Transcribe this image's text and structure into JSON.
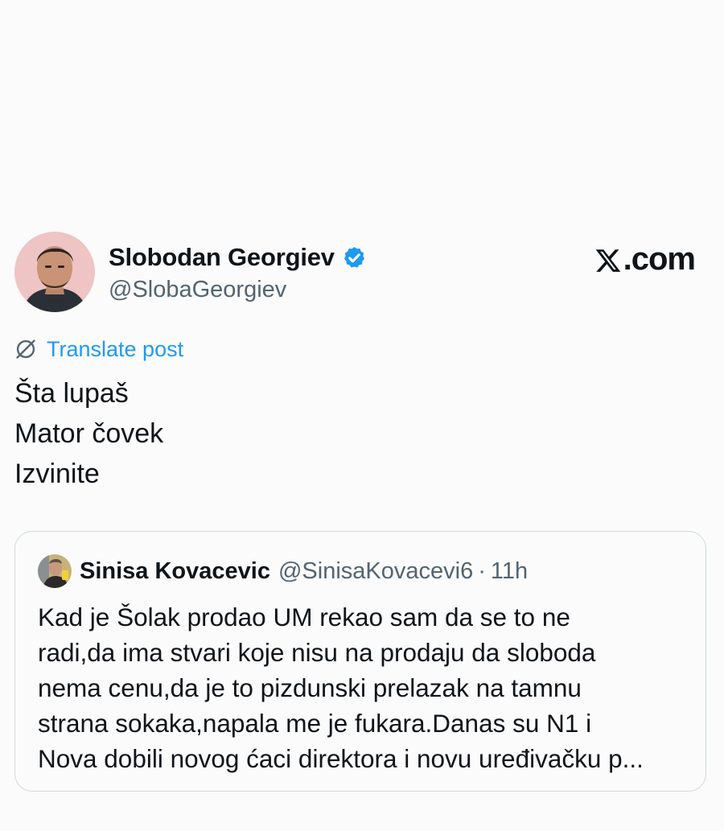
{
  "post": {
    "author": {
      "name": "Slobodan Georgiev",
      "handle": "@SlobaGeorgiev",
      "verified_icon": "verified-badge-icon",
      "verified_color": "#1d9bf0"
    },
    "brand": ".com",
    "translate_label": "Translate post",
    "text_lines": [
      "Šta lupaš",
      "Mator čovek",
      "Izvinite"
    ]
  },
  "quoted_post": {
    "author_name": "Sinisa Kovacevic",
    "handle": "@SinisaKovacevi6",
    "separator": "·",
    "time": "11h",
    "text_lines": [
      "Kad je Šolak prodao UM rekao sam da se to ne",
      "radi,da ima stvari koje nisu na prodaju da sloboda",
      "nema cenu,da je to pizdunski prelazak na tamnu",
      "strana sokaka,napala me je fukara.Danas su N1 i",
      "Nova dobili novog ćaci direktora i novu uređivačku p..."
    ]
  },
  "colors": {
    "accent": "#1d9bf0",
    "text": "#0f1419",
    "muted": "#536471",
    "border": "#cfd9de",
    "background": "#fbfbfb"
  }
}
